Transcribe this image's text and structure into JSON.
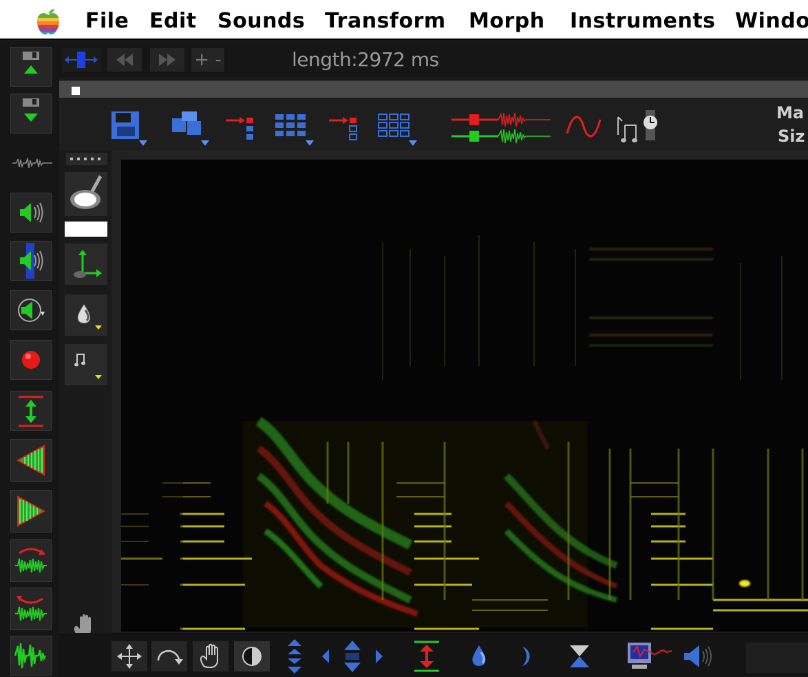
{
  "menubar": {
    "apple_icon": "apple-rainbow-icon",
    "items": [
      "File",
      "Edit",
      "Sounds",
      "Transform",
      "Morph",
      "Instruments",
      "Windo"
    ]
  },
  "transport": {
    "length_label": "length:2972 ms",
    "plus_minus": "+ -"
  },
  "tool_row": {
    "map_label": "Ma",
    "size_label": "Siz"
  },
  "colors": {
    "green": "#22cc22",
    "red": "#e02020",
    "blue": "#3a6fd8",
    "yellow": "#e8e020"
  },
  "icons": {
    "left_bar": [
      "save-up-icon",
      "save-down-icon",
      "waveform-icon",
      "play-icon",
      "play-selection-icon",
      "play-loop-icon",
      "record-icon",
      "expand-vertical-icon",
      "reverse-icon",
      "forward-icon",
      "sweep-up-icon",
      "sweep-down-icon",
      "waveform-split-icon"
    ],
    "palette": [
      "palette-dots-icon",
      "brush-icon",
      "color-swatch",
      "axes-tool-icon",
      "water-drop-icon",
      "note-icon",
      "hand-icon"
    ],
    "bottom": [
      "move-icon",
      "rotate-icon",
      "grab-hand-icon",
      "contrast-icon",
      "vertical-arrows-icon",
      "nav-arrows-icon",
      "expand-red-icon",
      "drop-blue-icon",
      "moon-icon",
      "hourglass-icon",
      "monitor-wave-icon",
      "speaker-icon"
    ]
  }
}
